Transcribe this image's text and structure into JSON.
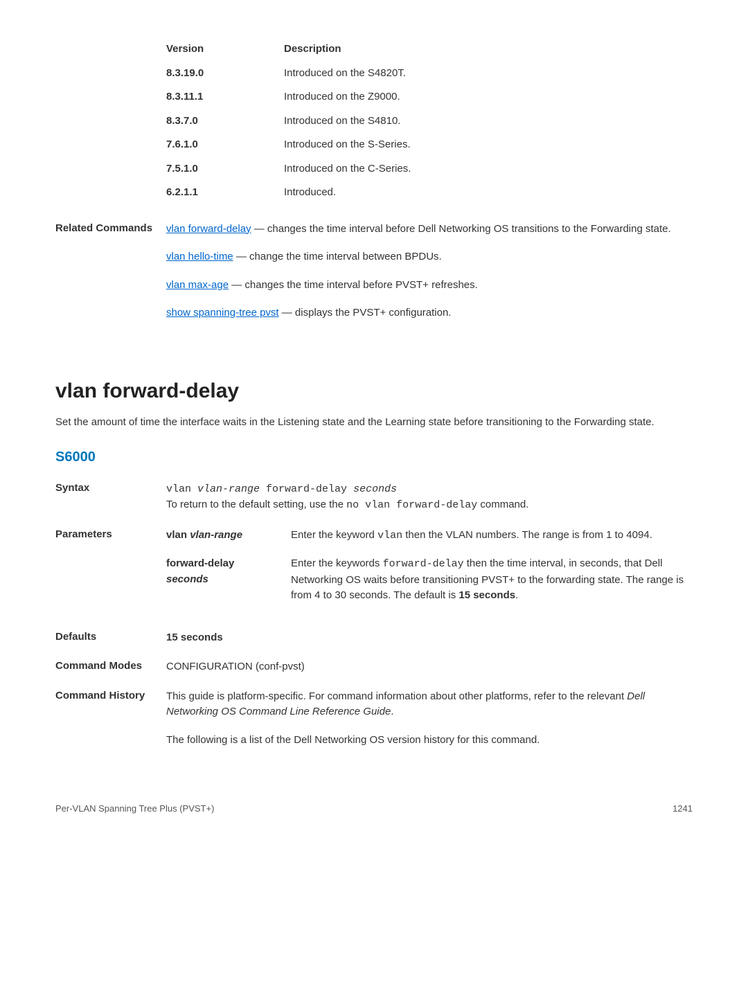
{
  "version_table": {
    "headers": {
      "version": "Version",
      "description": "Description"
    },
    "rows": [
      {
        "version": "8.3.19.0",
        "description": "Introduced on the S4820T."
      },
      {
        "version": "8.3.11.1",
        "description": "Introduced on the Z9000."
      },
      {
        "version": "8.3.7.0",
        "description": "Introduced on the S4810."
      },
      {
        "version": "7.6.1.0",
        "description": "Introduced on the S-Series."
      },
      {
        "version": "7.5.1.0",
        "description": "Introduced on the C-Series."
      },
      {
        "version": "6.2.1.1",
        "description": "Introduced."
      }
    ]
  },
  "related": {
    "label": "Related Commands",
    "items": [
      {
        "link": "vlan forward-delay",
        "text": " — changes the time interval before Dell Networking OS transitions to the Forwarding state."
      },
      {
        "link": "vlan hello-time",
        "text": " — change the time interval between BPDUs."
      },
      {
        "link": "vlan max-age",
        "text": " — changes the time interval before PVST+ refreshes."
      },
      {
        "link": "show spanning-tree pvst",
        "text": " — displays the PVST+ configuration."
      }
    ]
  },
  "heading": "vlan forward-delay",
  "intro": "Set the amount of time the interface waits in the Listening state and the Learning state before transitioning to the Forwarding state.",
  "platform": "S6000",
  "syntax": {
    "label": "Syntax",
    "code_pre": "vlan ",
    "code_arg1": "vlan-range",
    "code_mid": " forward-delay ",
    "code_arg2": "seconds",
    "return_prefix": "To return to the default setting, use the ",
    "return_code": "no vlan forward-delay",
    "return_suffix": " command."
  },
  "parameters": {
    "label": "Parameters",
    "rows": [
      {
        "name_prefix": "vlan ",
        "name_italic": "vlan-range",
        "desc_prefix": "Enter the keyword ",
        "desc_code": "vlan",
        "desc_suffix": " then the VLAN numbers. The range is from 1 to 4094."
      },
      {
        "name_prefix": "forward-delay ",
        "name_italic": "seconds",
        "desc_prefix": "Enter the keywords ",
        "desc_code": "forward-delay",
        "desc_mid": " then the time interval, in seconds, that Dell Networking OS waits before transitioning PVST+ to the forwarding state. The range is from 4 to 30 seconds. The default is ",
        "desc_bold": "15 seconds",
        "desc_suffix2": "."
      }
    ]
  },
  "defaults": {
    "label": "Defaults",
    "value": "15 seconds"
  },
  "command_modes": {
    "label": "Command Modes",
    "value": "CONFIGURATION (conf-pvst)"
  },
  "command_history": {
    "label": "Command History",
    "p1_prefix": "This guide is platform-specific. For command information about other platforms, refer to the relevant ",
    "p1_italic": "Dell Networking OS Command Line Reference Guide",
    "p1_suffix": ".",
    "p2": "The following is a list of the Dell Networking OS version history for this command."
  },
  "footer": {
    "left": "Per-VLAN Spanning Tree Plus (PVST+)",
    "right": "1241"
  }
}
